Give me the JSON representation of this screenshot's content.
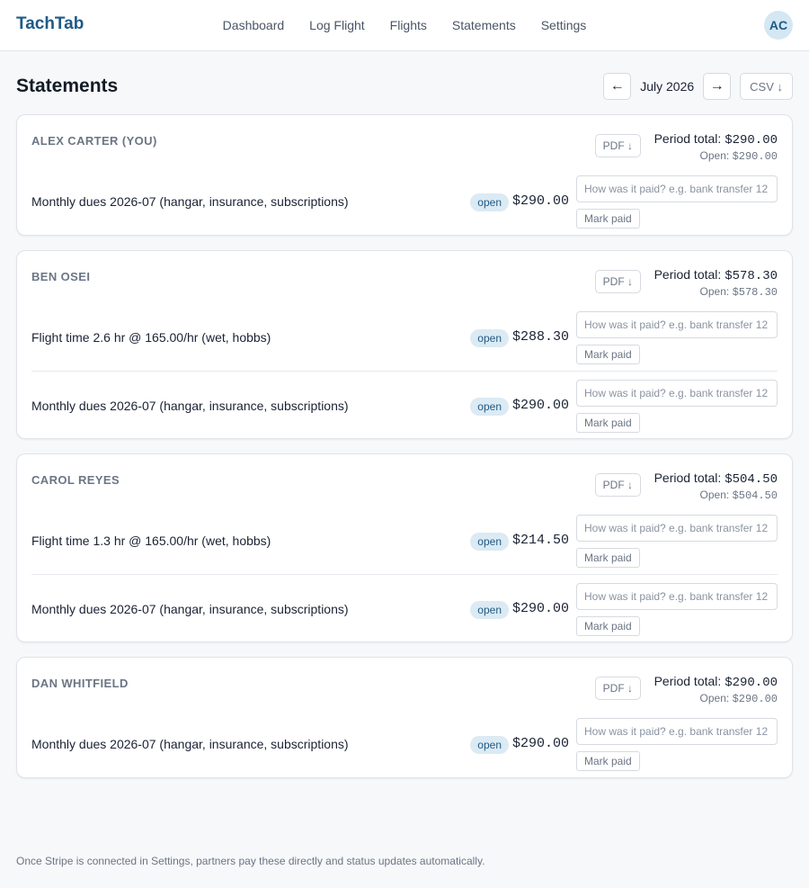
{
  "app": {
    "brand": "TachTab",
    "nav": [
      "Dashboard",
      "Log Flight",
      "Flights",
      "Statements",
      "Settings"
    ],
    "avatar_initials": "AC"
  },
  "page": {
    "title": "Statements",
    "prev_icon": "arrow-left-icon",
    "next_icon": "arrow-right-icon",
    "prev_label": "←",
    "next_label": "→",
    "period": "July 2026",
    "csv_label": "CSV ↓"
  },
  "labels": {
    "pdf": "PDF ↓",
    "period_total_prefix": "Period total: ",
    "open_prefix": "Open: ",
    "mark_paid": "Mark paid",
    "paid_placeholder": "How was it paid? e.g. bank transfer 12"
  },
  "statements": [
    {
      "member": "ALEX CARTER (YOU)",
      "period_total": "$290.00",
      "open_total": "$290.00",
      "lines": [
        {
          "description": "Monthly dues 2026-07 (hangar, insurance, subscriptions)",
          "status": "open",
          "amount": "$290.00"
        }
      ]
    },
    {
      "member": "BEN OSEI",
      "period_total": "$578.30",
      "open_total": "$578.30",
      "lines": [
        {
          "description": "Flight time 2.6 hr @ 165.00/hr (wet, hobbs)",
          "status": "open",
          "amount": "$288.30"
        },
        {
          "description": "Monthly dues 2026-07 (hangar, insurance, subscriptions)",
          "status": "open",
          "amount": "$290.00"
        }
      ]
    },
    {
      "member": "CAROL REYES",
      "period_total": "$504.50",
      "open_total": "$504.50",
      "lines": [
        {
          "description": "Flight time 1.3 hr @ 165.00/hr (wet, hobbs)",
          "status": "open",
          "amount": "$214.50"
        },
        {
          "description": "Monthly dues 2026-07 (hangar, insurance, subscriptions)",
          "status": "open",
          "amount": "$290.00"
        }
      ]
    },
    {
      "member": "DAN WHITFIELD",
      "period_total": "$290.00",
      "open_total": "$290.00",
      "lines": [
        {
          "description": "Monthly dues 2026-07 (hangar, insurance, subscriptions)",
          "status": "open",
          "amount": "$290.00"
        }
      ]
    }
  ],
  "footnote": "Once Stripe is connected in Settings, partners pay these directly and status updates automatically.",
  "colors": {
    "brand": "#1f5a86",
    "badge_bg": "#dbeaf3",
    "page_bg": "#f7f8fa"
  }
}
